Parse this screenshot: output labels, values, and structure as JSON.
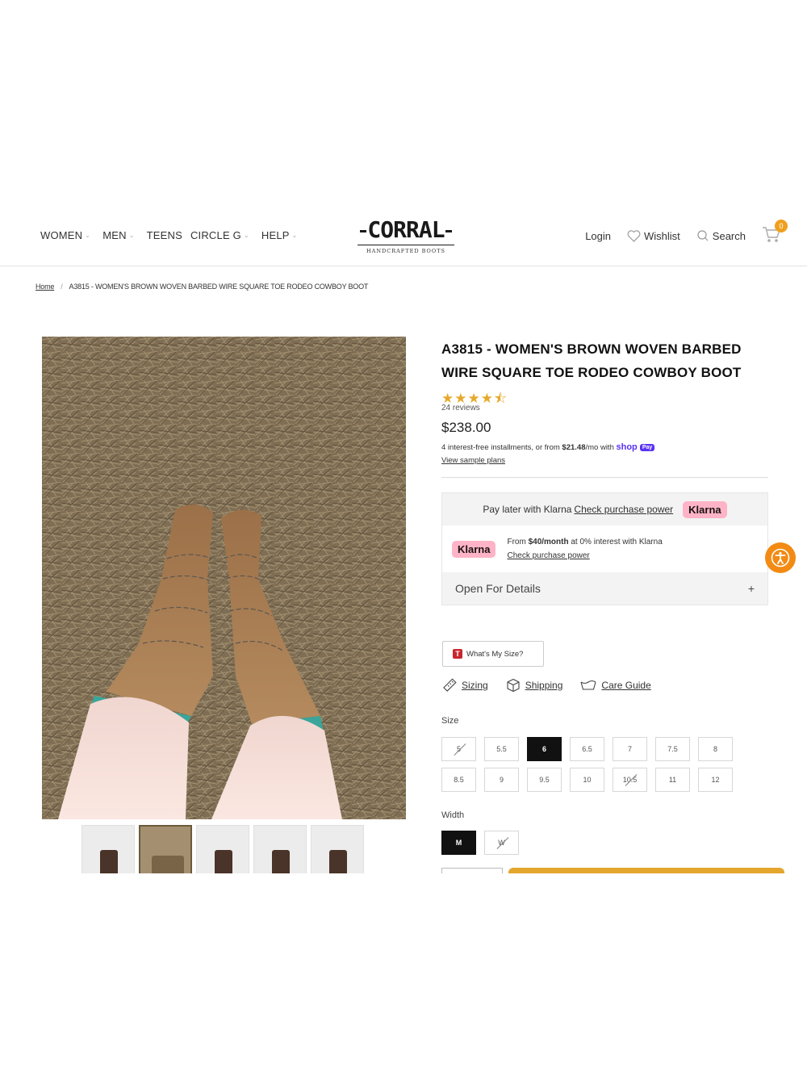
{
  "header": {
    "nav": [
      {
        "label": "WOMEN",
        "has_caret": true
      },
      {
        "label": "MEN",
        "has_caret": true
      },
      {
        "label": "TEENS",
        "has_caret": false
      },
      {
        "label": "CIRCLE G",
        "has_caret": true
      },
      {
        "label": "HELP",
        "has_caret": true
      }
    ],
    "logo": {
      "wordmark": "CORRAL",
      "tagline": "HANDCRAFTED BOOTS"
    },
    "login": "Login",
    "wishlist": "Wishlist",
    "search": "Search",
    "cart_count": "0"
  },
  "breadcrumb": {
    "home": "Home",
    "current": "A3815 - WOMEN'S BROWN WOVEN BARBED WIRE SQUARE TOE RODEO COWBOY BOOT"
  },
  "product": {
    "title": "A3815 - WOMEN'S BROWN WOVEN BARBED WIRE SQUARE TOE RODEO COWBOY BOOT",
    "rating": 4.5,
    "stars": "★★★★⯪",
    "reviews": "24 reviews",
    "price": "$238.00",
    "installments_prefix": "4 interest-free installments, or from ",
    "installments_amount": "$21.48",
    "installments_suffix": "/mo with ",
    "shop_pay": "shop",
    "shop_pay_pill": "Pay",
    "sample_plans": "View sample plans"
  },
  "klarna": {
    "top_text": "Pay later with Klarna",
    "top_link": "Check purchase power",
    "brand": "Klarna",
    "mid_prefix": "From ",
    "mid_amount": "$40/month",
    "mid_suffix": " at 0% interest with Klarna",
    "mid_link": "Check purchase power",
    "details": "Open For Details",
    "details_icon": "+"
  },
  "size_tool": {
    "logo": "T",
    "label": "What's My Size?"
  },
  "guides": {
    "sizing": "Sizing",
    "shipping": "Shipping",
    "care": "Care Guide"
  },
  "size": {
    "label": "Size",
    "options": [
      {
        "label": "5",
        "state": "unavailable"
      },
      {
        "label": "5.5",
        "state": "available"
      },
      {
        "label": "6",
        "state": "selected"
      },
      {
        "label": "6.5",
        "state": "available"
      },
      {
        "label": "7",
        "state": "available"
      },
      {
        "label": "7.5",
        "state": "available"
      },
      {
        "label": "8",
        "state": "available"
      },
      {
        "label": "8.5",
        "state": "available"
      },
      {
        "label": "9",
        "state": "available"
      },
      {
        "label": "9.5",
        "state": "available"
      },
      {
        "label": "10",
        "state": "available"
      },
      {
        "label": "10.5",
        "state": "unavailable"
      },
      {
        "label": "11",
        "state": "available"
      },
      {
        "label": "12",
        "state": "available"
      }
    ]
  },
  "width": {
    "label": "Width",
    "options": [
      {
        "label": "M",
        "state": "selected"
      },
      {
        "label": "W",
        "state": "unavailable"
      }
    ]
  },
  "colors": {
    "accent": "#e4a62d",
    "star": "#e6a92b",
    "klarna_pink": "#ffb3c7",
    "accessibility": "#f28a14"
  }
}
